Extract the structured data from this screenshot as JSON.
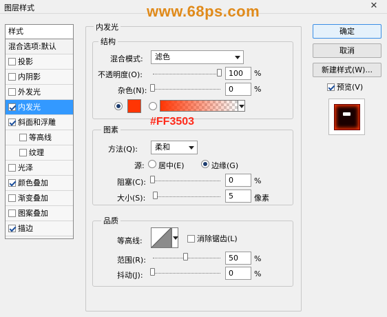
{
  "window": {
    "title": "图层样式",
    "watermark": "www.68ps.com",
    "close": "✕"
  },
  "styles": {
    "header": "样式",
    "blend_default": "混合选项:默认",
    "items": [
      {
        "label": "投影",
        "checked": false
      },
      {
        "label": "内阴影",
        "checked": false
      },
      {
        "label": "外发光",
        "checked": false
      },
      {
        "label": "内发光",
        "checked": true,
        "selected": true
      },
      {
        "label": "斜面和浮雕",
        "checked": true
      },
      {
        "label": "等高线",
        "checked": false,
        "sub": true
      },
      {
        "label": "纹理",
        "checked": false,
        "sub": true
      },
      {
        "label": "光泽",
        "checked": false
      },
      {
        "label": "颜色叠加",
        "checked": true
      },
      {
        "label": "渐变叠加",
        "checked": false
      },
      {
        "label": "图案叠加",
        "checked": false
      },
      {
        "label": "描边",
        "checked": true
      }
    ]
  },
  "panel": {
    "title": "内发光",
    "structure": {
      "title": "结构",
      "blend_mode_label": "混合模式:",
      "blend_mode_value": "滤色",
      "opacity_label": "不透明度(O):",
      "opacity_value": "100",
      "opacity_unit": "%",
      "noise_label": "杂色(N):",
      "noise_value": "0",
      "noise_unit": "%"
    },
    "elements": {
      "title": "图素",
      "method_label": "方法(Q):",
      "method_value": "柔和",
      "source_label": "源:",
      "source_center": "居中(E)",
      "source_edge": "边缘(G)",
      "choke_label": "阻塞(C):",
      "choke_value": "0",
      "choke_unit": "%",
      "size_label": "大小(S):",
      "size_value": "5",
      "size_unit": "像素"
    },
    "quality": {
      "title": "品质",
      "contour_label": "等高线:",
      "antialias_label": "消除锯齿(L)",
      "range_label": "范围(R):",
      "range_value": "50",
      "range_unit": "%",
      "jitter_label": "抖动(J):",
      "jitter_value": "0",
      "jitter_unit": "%"
    }
  },
  "annotation": "#FF3503",
  "colors": {
    "glow": "#ff3503",
    "selection": "#3399ff",
    "watermark": "#e08a1a"
  },
  "buttons": {
    "ok": "确定",
    "cancel": "取消",
    "new_style": "新建样式(W)...",
    "preview": "预览(V)"
  }
}
